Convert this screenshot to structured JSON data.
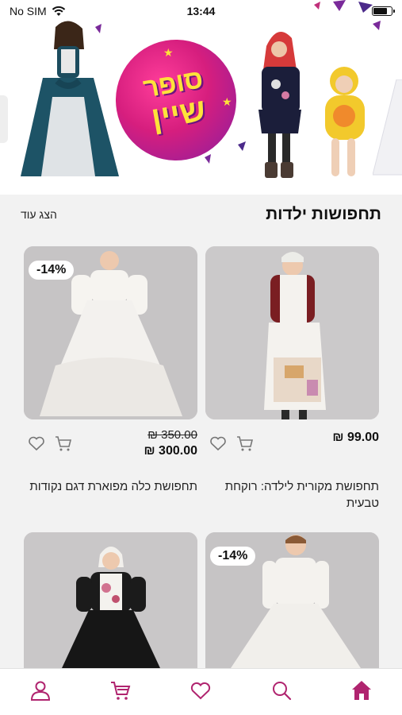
{
  "status_bar": {
    "carrier": "No SIM",
    "time": "13:44",
    "battery_level": 0.85
  },
  "banner": {
    "logo_line1": "סופר",
    "logo_line2": "שיין"
  },
  "section": {
    "title": "תחפושות ילדות",
    "show_more": "הצג עוד"
  },
  "products": [
    {
      "price": "₪ 99.00",
      "title": "תחפושת מקורית לילדה: רוקחת טבעית"
    },
    {
      "badge": "-14%",
      "old_price": "₪ 350.00",
      "new_price": "₪ 300.00",
      "title": "תחפושת כלה מפוארת דגם נקודות"
    },
    {
      "badge": "-14%"
    },
    {}
  ],
  "nav": {
    "active": "home",
    "items": [
      "home-icon",
      "search-icon",
      "heart-icon",
      "cart-icon",
      "user-icon"
    ],
    "accent": "#b0246f"
  }
}
